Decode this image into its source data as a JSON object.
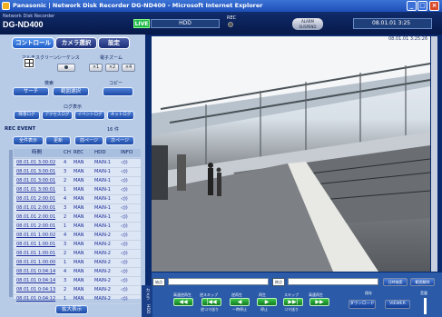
{
  "window": {
    "title": "Panasonic | Network Disk Recorder DG-ND400 - Microsoft Internet Explorer"
  },
  "header": {
    "brand_small": "Network Disk Recorder",
    "brand_model": "DG-ND400",
    "live": "LIVE",
    "hdd": "HDD",
    "rec_label": "REC",
    "alarm_label": "ALARM SUSPEND",
    "datetime": "08.01.01 3:25"
  },
  "tabs": [
    "コントロール",
    "カメラ選択",
    "設定"
  ],
  "left": {
    "multiscreen": "マルチスクリーン",
    "sequence": "シーケンス",
    "ezoom": "電子ズーム",
    "zoom": [
      "×1",
      "×2",
      "×4"
    ],
    "search_label": "検索",
    "search": "サーチ",
    "rangesel": "範囲選択",
    "copy_label": "コピー",
    "log_label": "ログ表示",
    "logs": [
      "障害ログ",
      "アクセスログ",
      "イベントログ",
      "ネットログ"
    ],
    "rec_event": "REC EVENT",
    "count": "16 件",
    "all": "全件表示",
    "refresh": "更新",
    "prev": "前ページ",
    "next": "次ページ",
    "enlarge": "拡大表示"
  },
  "table": {
    "headers": [
      "時間",
      "CH",
      "REC",
      "HDD",
      "INFO"
    ],
    "rows": [
      [
        "08.01.01 3:00:02",
        "4",
        "MAN",
        "MAIN-1",
        "◁))"
      ],
      [
        "08.01.01 3:00:01",
        "3",
        "MAN",
        "MAIN-1",
        "◁))"
      ],
      [
        "08.01.01 3:00:01",
        "2",
        "MAN",
        "MAIN-1",
        "◁))"
      ],
      [
        "08.01.01 3:00:01",
        "1",
        "MAN",
        "MAIN-1",
        "◁))"
      ],
      [
        "08.01.01 2:00:01",
        "4",
        "MAN",
        "MAIN-1",
        "◁))"
      ],
      [
        "08.01.01 2:00:01",
        "3",
        "MAN",
        "MAIN-1",
        "◁))"
      ],
      [
        "08.01.01 2:00:01",
        "2",
        "MAN",
        "MAIN-1",
        "◁))"
      ],
      [
        "08.01.01 2:00:01",
        "1",
        "MAN",
        "MAIN-1",
        "◁))"
      ],
      [
        "08.01.01 1:00:02",
        "4",
        "MAN",
        "MAIN-2",
        "◁))"
      ],
      [
        "08.01.01 1:00:01",
        "3",
        "MAN",
        "MAIN-2",
        "◁))"
      ],
      [
        "08.01.01 1:00:01",
        "2",
        "MAN",
        "MAIN-2",
        "◁))"
      ],
      [
        "08.01.01 1:00:00",
        "1",
        "MAN",
        "MAIN-2",
        "◁))"
      ],
      [
        "08.01.01 0:04:14",
        "4",
        "MAN",
        "MAIN-2",
        "◁))"
      ],
      [
        "08.01.01 0:04:14",
        "3",
        "MAN",
        "MAIN-2",
        "◁))"
      ],
      [
        "08.01.01 0:04:13",
        "2",
        "MAN",
        "MAIN-2",
        "◁))"
      ],
      [
        "08.01.01 0:04:12",
        "1",
        "MAN",
        "MAIN-2",
        "◁))"
      ]
    ]
  },
  "video": {
    "timestamp": "08.01.01 3:25:26"
  },
  "playback": {
    "start": "始点",
    "end": "終点",
    "datetime_search": "日時検索",
    "clear": "範囲解除",
    "labels": [
      "高速逆再生",
      "逆スキップ",
      "逆再生",
      "再生",
      "スキップ",
      "高速再生"
    ],
    "labels2": [
      "逆コマ送り",
      "一時停止",
      "停止",
      "コマ送り"
    ],
    "save": "保存",
    "download": "ダウンロード",
    "viewer": "VIEWER",
    "volume": "音量",
    "vtab": "カメラ　HDD"
  }
}
